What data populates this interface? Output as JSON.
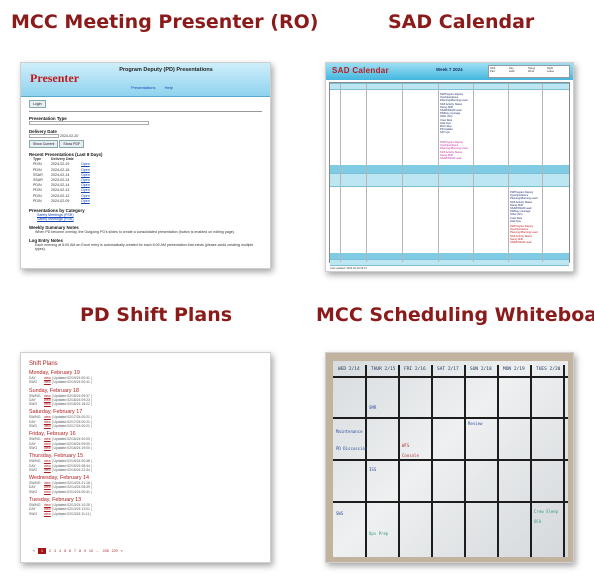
{
  "tiles": [
    {
      "title": "MCC Meeting Presenter (RO)"
    },
    {
      "title": "SAD Calendar"
    },
    {
      "title": "PD Shift Plans"
    },
    {
      "title": "MCC Scheduling Whiteboard"
    }
  ],
  "presenter": {
    "logo": "Presenter",
    "title": "Program Deputy (PD) Presentations",
    "nav": [
      "Presentations",
      "Help"
    ],
    "login": "Login",
    "type_label": "Presentation Type",
    "delivery_label": "Delivery Date",
    "date_value": "2024-02-20",
    "buttons": [
      "Show Current",
      "Show PDF"
    ],
    "recent_heading": "Recent Presentations (Last 8 Days)",
    "table_header": [
      "Type",
      "Delivery Date",
      ""
    ],
    "recent_rows": [
      [
        "PD/N",
        "2024-02-19",
        "Open"
      ],
      [
        "PD/N",
        "2024-02-16",
        "Open"
      ],
      [
        "SSAR",
        "2024-02-14",
        "Open"
      ],
      [
        "SSAR",
        "2024-02-14",
        "Open"
      ],
      [
        "PD/N",
        "2024-02-14",
        "Open"
      ],
      [
        "PD/N",
        "2024-02-13",
        "Open"
      ],
      [
        "PD/N",
        "2024-02-12",
        "Open"
      ],
      [
        "PD/N",
        "2024-02-09",
        "Open"
      ]
    ],
    "category_heading": "Presentations by Category",
    "categories": [
      "Safety Meetings (PSR)",
      "Safety Meetings (PSR)"
    ],
    "weekly_heading": "Weekly Summary Notes",
    "weekly_text": "When PD become overlay, the Outgoing PD's slides to create a consolidated presentation (button is enabled on editing page).",
    "log_heading": "Log Entry Notes",
    "log_text": "Each morning at 8:00 AM an Excel entry is automatically created for each 8:00 AM presentation that exists (please avoid creating multiple types)."
  },
  "calendar": {
    "title": "SAD Calendar",
    "week": "Week 7 2024",
    "legend": [
      "Shift",
      "Day",
      "Swing",
      "Night",
      "Pad",
      "Hold",
      "Work",
      "Leave"
    ],
    "cell_lines": [
      "PD/Program Deputy",
      "Ops/Operations",
      "Planning/Planning Lead",
      "Shift Activity Status",
      "Swing Shift",
      "SSAR/SSAR Lead",
      "PD/Day coverage",
      "Other (6/1)",
      "Crew Rest",
      "Hold Ops",
      "MCC Rep",
      "PD Update",
      "SAT ops"
    ],
    "footer": "Last updated: 2024-02-20 06:12"
  },
  "shift_plans": {
    "title": "Shift Plans",
    "days": [
      {
        "day": "Monday, February 19",
        "rows": [
          [
            "DAY",
            "view",
            "| Updated 02/19/24 00:41 |"
          ],
          [
            "SWG",
            "view",
            "| Updated 02/19/24 00:41 |"
          ]
        ]
      },
      {
        "day": "Sunday, February 18",
        "rows": [
          [
            "SW/NG",
            "view",
            "| Updated 02/18/24 09:37 |"
          ],
          [
            "DAY",
            "view",
            "| Updated 02/18/24 09:23 |"
          ],
          [
            "SWG",
            "view",
            "| Updated 02/18/24 18:22 |"
          ]
        ]
      },
      {
        "day": "Saturday, February 17",
        "rows": [
          [
            "SW/NG",
            "view",
            "| Updated 02/17/24 00:21 |"
          ],
          [
            "DAY",
            "view",
            "| Updated 02/17/24 00:21 |"
          ],
          [
            "SWG",
            "view",
            "| Updated 02/17/24 00:21 |"
          ]
        ]
      },
      {
        "day": "Friday, February 16",
        "rows": [
          [
            "SW/NG",
            "view",
            "| Updated 02/16/24 00:00 |"
          ],
          [
            "DAY",
            "view",
            "| Updated 02/16/24 09:00 |"
          ],
          [
            "SWG",
            "view",
            "| Updated 02/16/24 19:00 |"
          ]
        ]
      },
      {
        "day": "Thursday, February 15",
        "rows": [
          [
            "SW/NG",
            "view",
            "| Updated 02/15/24 00:48 |"
          ],
          [
            "DAY",
            "view",
            "| Updated 02/15/24 08:44 |"
          ],
          [
            "SWG",
            "view",
            "| Updated 02/15/24 22:34 |"
          ]
        ]
      },
      {
        "day": "Wednesday, February 14",
        "rows": [
          [
            "SW/NG",
            "view",
            "| Updated 02/14/24 21:16 |"
          ],
          [
            "DAY",
            "view",
            "| Updated 02/14/24 08:39 |"
          ],
          [
            "SWG",
            "view",
            "| Updated 02/14/24 00:41 |"
          ]
        ]
      },
      {
        "day": "Tuesday, February 13",
        "rows": [
          [
            "SW/NG",
            "view",
            "| Updated 02/13/24 10:25 |"
          ],
          [
            "DAY",
            "view",
            "| Updated 02/13/24 13:01 |"
          ],
          [
            "SWG",
            "view",
            "| Updated 02/13/24 11:11 |"
          ]
        ]
      }
    ],
    "pager": [
      "«",
      "1",
      "2",
      "3",
      "4",
      "5",
      "6",
      "7",
      "8",
      "9",
      "10",
      "…",
      "228",
      "229",
      "»"
    ]
  },
  "whiteboard": {
    "days": [
      "WED 2/14",
      "THUR 2/15",
      "FRI 2/16",
      "SAT 2/17",
      "SUN 2/18",
      "MON 2/19",
      "TUES 2/20"
    ],
    "notes": [
      "Maintenance",
      "PD Discussion",
      "SMR",
      "ISS",
      "WFS",
      "Console",
      "Ops Prep",
      "SWS",
      "Crew Sleep",
      "OCA",
      "Review"
    ],
    "ink_blue": "#2a4e9b",
    "ink_red": "#b83030",
    "ink_green": "#2f9a7f"
  }
}
